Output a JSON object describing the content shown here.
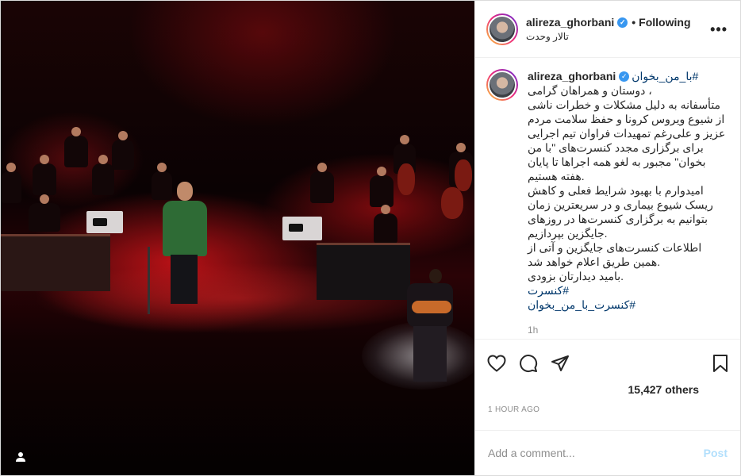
{
  "post": {
    "username": "alireza_ghorbani",
    "follow_status": "Following",
    "location": "تالار وحدت",
    "more_label": "•••"
  },
  "caption": {
    "username": "alireza_ghorbani",
    "first_hashtag": "#با_من_بخوان",
    "lines": [
      "، دوستان و همراهان گرامی",
      "متأسفانه به دلیل مشکلات و خطرات ناشی",
      "از شیوع ویروس کرونا و حفظ سلامت مردم",
      "عزیز و علی‌رغم تمهیدات فراوان تیم اجرایی",
      "برای برگزاری مجدد کنسرت‌های \"با من",
      "بخوان\" مجبور به لغو همه اجراها تا پایان",
      ".هفته هستیم",
      "امیدوارم با بهبود شرایط فعلی و کاهش",
      "ریسک شیوع بیماری و در سریعترین زمان",
      "بتوانیم به برگزاری کنسرت‌ها در روزهای",
      ".جایگزین بپردازیم",
      "اطلاعات کنسرت‌های جایگزین و آتی از",
      ".همین طریق اعلام خواهد شد",
      ".بامید دیدارتان بزودی"
    ],
    "hashtags": [
      "#کنسرت",
      "#کنسرت_با_من_بخوان"
    ],
    "time": "1h"
  },
  "likes": "15,427 others",
  "timestamp": "1 HOUR AGO",
  "comment": {
    "placeholder": "Add a comment...",
    "post_label": "Post"
  },
  "icons": {
    "like": "heart-icon",
    "comment": "comment-icon",
    "share": "paper-plane-icon",
    "save": "bookmark-icon",
    "verified": "verified-badge-icon",
    "user_tag": "user-tag-icon"
  },
  "colors": {
    "link": "#00376b",
    "verified": "#3897f0",
    "post_button": "#b2dffc",
    "muted": "#8e8e8e"
  }
}
